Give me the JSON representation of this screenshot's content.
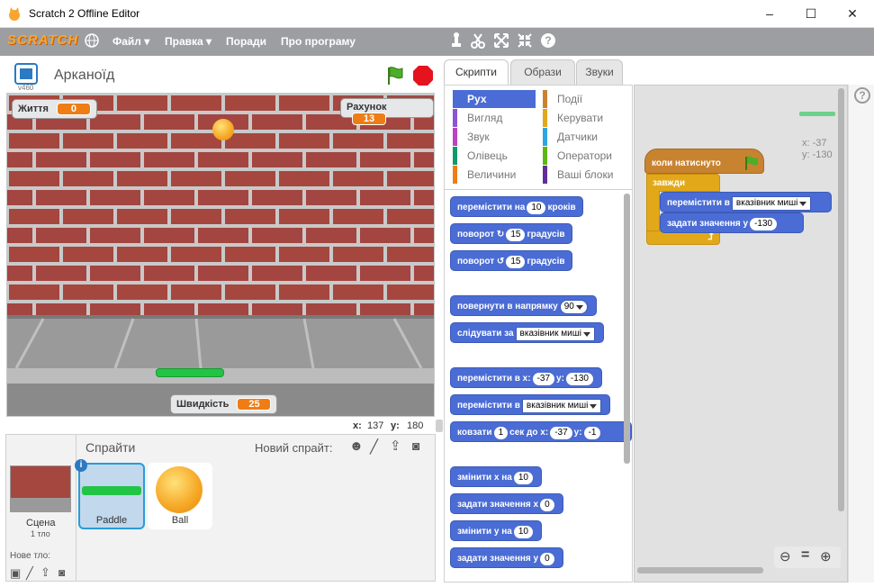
{
  "window": {
    "title": "Scratch 2 Offline Editor",
    "minimize": "–",
    "maximize": "☐",
    "close": "✕"
  },
  "menubar": {
    "logo": "SCRATCH",
    "file": "Файл ▾",
    "edit": "Правка ▾",
    "tips": "Поради",
    "about": "Про програму",
    "tools": [
      "stamp-icon",
      "scissors-icon",
      "grow-icon",
      "shrink-icon",
      "help-icon"
    ]
  },
  "stage": {
    "project_title": "Арканоїд",
    "version": "v460",
    "lives_label": "Життя",
    "lives_value": "0",
    "score_label": "Рахунок",
    "score_value": "13",
    "speed_label": "Швидкість",
    "speed_value": "25",
    "x_label": "x:",
    "x_value": "137",
    "y_label": "y:",
    "y_value": "180",
    "colors": {
      "brick": "#a5473f",
      "mortar": "#c9c9c9",
      "floor": "#8d8d8d",
      "paddle": "#22c445",
      "ball": "#f5a623"
    }
  },
  "sprites": {
    "header": "Спрайти",
    "new_sprite": "Новий спрайт:",
    "scene_label": "Сцена",
    "scene_sub": "1 тло",
    "new_backdrop": "Нове тло:",
    "items": [
      {
        "name": "Paddle",
        "selected": true
      },
      {
        "name": "Ball",
        "selected": false
      }
    ]
  },
  "tabs": [
    "Скрипти",
    "Образи",
    "Звуки"
  ],
  "categories": {
    "left": [
      {
        "label": "Рух",
        "color": "#4a6cd4",
        "active": true
      },
      {
        "label": "Вигляд",
        "color": "#8a55d7"
      },
      {
        "label": "Звук",
        "color": "#bb42c3"
      },
      {
        "label": "Олівець",
        "color": "#0e9a6c"
      },
      {
        "label": "Величини",
        "color": "#ee7d16"
      }
    ],
    "right": [
      {
        "label": "Події",
        "color": "#c88330"
      },
      {
        "label": "Керувати",
        "color": "#e1a91a"
      },
      {
        "label": "Датчики",
        "color": "#2ca5e2"
      },
      {
        "label": "Оператори",
        "color": "#5cb712"
      },
      {
        "label": "Ваші блоки",
        "color": "#632d99"
      }
    ]
  },
  "palette": {
    "move": {
      "a": "перемістити на",
      "v": "10",
      "b": "кроків"
    },
    "turn_right": {
      "a": "поворот",
      "v": "15",
      "b": "градусів"
    },
    "turn_left": {
      "a": "поворот",
      "v": "15",
      "b": "градусів"
    },
    "point_dir": {
      "a": "повернути в напрямку",
      "v": "90"
    },
    "point_towards": {
      "a": "слідувати за",
      "v": "вказівник миші"
    },
    "goto_xy": {
      "a": "перемістити в x:",
      "x": "-37",
      "b": "y:",
      "y": "-130"
    },
    "goto": {
      "a": "перемістити в",
      "v": "вказівник миші"
    },
    "glide": {
      "a": "ковзати",
      "s": "1",
      "b": "сек до x:",
      "x": "-37",
      "c": "y:",
      "y": "-1"
    },
    "change_x": {
      "a": "змінити х на",
      "v": "10"
    },
    "set_x": {
      "a": "задати значення х",
      "v": "0"
    },
    "change_y": {
      "a": "змінити у на",
      "v": "10"
    },
    "set_y": {
      "a": "задати значення у",
      "v": "0"
    }
  },
  "script": {
    "hat": "коли натиснуто",
    "forever": "завжди",
    "goto_a": "перемістити в",
    "goto_v": "вказівник миші",
    "sety_a": "задати значення у",
    "sety_v": "-130",
    "x_readout": "x: -37",
    "y_readout": "y: -130"
  }
}
